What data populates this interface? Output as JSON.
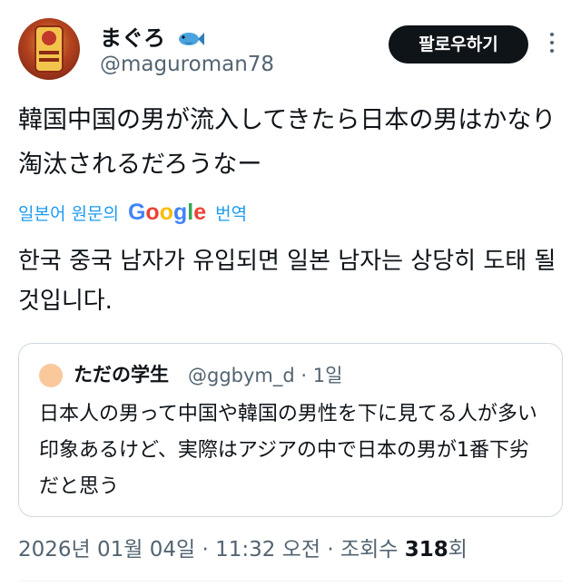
{
  "author": {
    "display_name": "まぐろ",
    "handle": "@maguroman78",
    "name_emoji": "fish-icon",
    "avatar_icon": "avatar-icon"
  },
  "actions": {
    "follow_label": "팔로우하기",
    "more_icon": "more-icon"
  },
  "tweet": {
    "text": "韓国中国の男が流入してきたら日本の男はかなり淘汰されるだろうなー",
    "translate_prefix": "일본어 원문의",
    "translate_suffix": "번역",
    "google_logo_text": "Google",
    "translated_text": "한국 중국 남자가 유입되면 일본 남자는 상당히 도태 될 것입니다."
  },
  "quote": {
    "author_name": "ただの学生",
    "handle_and_time": "@ggbym_d · 1일",
    "text": "日本人の男って中国や韓国の男性を下に見てる人が多い印象あるけど、実際はアジアの中で日本の男が1番下劣だと思う"
  },
  "meta": {
    "timestamp": "2026년 01월 04일 · 11:32 오전 · 조회수",
    "views": "318",
    "views_suffix": "회"
  },
  "colors": {
    "link_blue": "#1d9bf0",
    "text_primary": "#0f1419",
    "text_secondary": "#536471",
    "border": "#cfd9de"
  }
}
